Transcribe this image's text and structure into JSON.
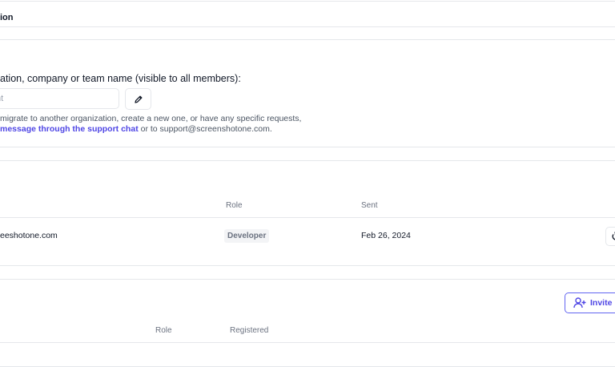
{
  "organization_section": {
    "title": "ion"
  },
  "organization_name": {
    "label": "ation, company or team name (visible to all members):",
    "value": "",
    "placeholder": "nt",
    "edit_icon": "pencil-icon",
    "help_line1": "migrate to another organization, create a new one, or have any specific requests,",
    "help_link": "message through the support chat",
    "help_rest": " or to support@screenshotone.com."
  },
  "invitations": {
    "columns": [
      "Role",
      "Sent"
    ],
    "rows": [
      {
        "email": "eeshotone.com",
        "role": "Developer",
        "sent": "Feb 26, 2024",
        "action_icon": "resend-icon"
      }
    ]
  },
  "members": {
    "invite_button": "Invite m",
    "invite_icon": "user-plus-icon",
    "columns": [
      "Role",
      "Registered"
    ]
  },
  "colors": {
    "accent": "#4f46e5",
    "border": "#e5e7eb",
    "muted_text": "#6b7280",
    "badge_bg": "#f3f4f6"
  }
}
